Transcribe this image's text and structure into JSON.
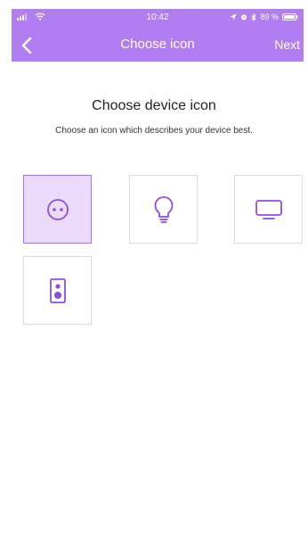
{
  "status_bar": {
    "time": "10:42",
    "battery": "89 %"
  },
  "nav": {
    "title": "Choose icon",
    "next_label": "Next"
  },
  "content": {
    "title": "Choose device icon",
    "subtitle": "Choose an icon which describes your device best."
  },
  "icons": [
    {
      "name": "socket-icon",
      "selected": true
    },
    {
      "name": "lightbulb-icon",
      "selected": false
    },
    {
      "name": "tv-icon",
      "selected": false
    },
    {
      "name": "speaker-icon",
      "selected": false
    }
  ],
  "colors": {
    "accent": "#b07ef0",
    "icon": "#8e4fd8",
    "selected_tile": "#eadbfd"
  }
}
